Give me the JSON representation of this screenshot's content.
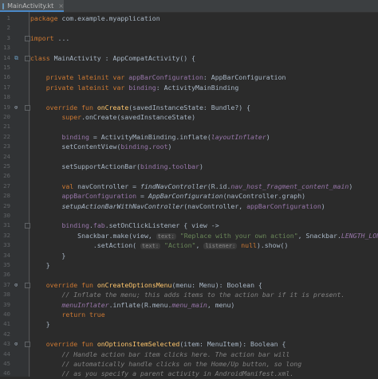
{
  "tab": {
    "label": "MainActivity.kt",
    "close": "×",
    "icon": "kotlin-file-icon"
  },
  "colors": {
    "keyword": "#cc7832",
    "function": "#ffc66d",
    "string": "#6a8759",
    "comment": "#808080",
    "field": "#9876aa",
    "text": "#a9b7c6",
    "background": "#2b2b2b",
    "gutter": "#313335"
  },
  "lines": [
    {
      "n": "1",
      "s": [
        [
          "kw",
          "package "
        ],
        [
          "",
          "com.example.myapplication"
        ]
      ]
    },
    {
      "n": "2",
      "s": []
    },
    {
      "n": "3",
      "s": [
        [
          "kw",
          "import "
        ],
        [
          "",
          "..."
        ]
      ],
      "fold": true
    },
    {
      "n": "13",
      "s": []
    },
    {
      "n": "14",
      "s": [
        [
          "kw",
          "class "
        ],
        [
          "",
          "MainActivity : AppCompatActivity() {"
        ]
      ],
      "marker": "class",
      "fold": true
    },
    {
      "n": "15",
      "s": []
    },
    {
      "n": "16",
      "s": [
        [
          "",
          "    "
        ],
        [
          "kw",
          "private lateinit var "
        ],
        [
          "fld",
          "appBarConfiguration"
        ],
        [
          "",
          ": AppBarConfiguration"
        ]
      ]
    },
    {
      "n": "17",
      "s": [
        [
          "",
          "    "
        ],
        [
          "kw",
          "private lateinit var "
        ],
        [
          "fld",
          "binding"
        ],
        [
          "",
          ": ActivityMainBinding"
        ]
      ]
    },
    {
      "n": "18",
      "s": []
    },
    {
      "n": "19",
      "s": [
        [
          "",
          "    "
        ],
        [
          "kw",
          "override fun "
        ],
        [
          "fn",
          "onCreate"
        ],
        [
          "",
          "(savedInstanceState: Bundle?) {"
        ]
      ],
      "marker": "override",
      "fold": true
    },
    {
      "n": "20",
      "s": [
        [
          "",
          "        "
        ],
        [
          "kw",
          "super"
        ],
        [
          "",
          ".onCreate(savedInstanceState)"
        ]
      ]
    },
    {
      "n": "21",
      "s": []
    },
    {
      "n": "22",
      "s": [
        [
          "",
          "        "
        ],
        [
          "fld",
          "binding"
        ],
        [
          "",
          " = ActivityMainBinding.inflate("
        ],
        [
          "fldi",
          "layoutInflater"
        ],
        [
          "",
          ")"
        ]
      ]
    },
    {
      "n": "23",
      "s": [
        [
          "",
          "        setContentView("
        ],
        [
          "fld",
          "binding"
        ],
        [
          "",
          "."
        ],
        [
          "fld",
          "root"
        ],
        [
          "",
          ")"
        ]
      ]
    },
    {
      "n": "24",
      "s": []
    },
    {
      "n": "25",
      "s": [
        [
          "",
          "        setSupportActionBar("
        ],
        [
          "fld",
          "binding"
        ],
        [
          "",
          "."
        ],
        [
          "fld",
          "toolbar"
        ],
        [
          "",
          ")"
        ]
      ]
    },
    {
      "n": "26",
      "s": []
    },
    {
      "n": "27",
      "s": [
        [
          "",
          "        "
        ],
        [
          "kw",
          "val "
        ],
        [
          "",
          "navController = "
        ],
        [
          "it",
          "findNavController"
        ],
        [
          "",
          "(R.id."
        ],
        [
          "fldi",
          "nav_host_fragment_content_main"
        ],
        [
          "",
          ")"
        ]
      ]
    },
    {
      "n": "28",
      "s": [
        [
          "",
          "        "
        ],
        [
          "fld",
          "appBarConfiguration"
        ],
        [
          "",
          " = "
        ],
        [
          "it",
          "AppBarConfiguration"
        ],
        [
          "",
          "(navController.graph)"
        ]
      ]
    },
    {
      "n": "29",
      "s": [
        [
          "",
          "        "
        ],
        [
          "it",
          "setupActionBarWithNavController"
        ],
        [
          "",
          "(navController, "
        ],
        [
          "fld",
          "appBarConfiguration"
        ],
        [
          "",
          ")"
        ]
      ]
    },
    {
      "n": "30",
      "s": []
    },
    {
      "n": "31",
      "s": [
        [
          "",
          "        "
        ],
        [
          "fld",
          "binding"
        ],
        [
          "",
          "."
        ],
        [
          "fld",
          "fab"
        ],
        [
          "",
          ".setOnClickListener { view ->"
        ]
      ],
      "fold": true
    },
    {
      "n": "32",
      "s": [
        [
          "",
          "            Snackbar.make(view, "
        ],
        [
          "hint",
          "text:"
        ],
        [
          "",
          " "
        ],
        [
          "str",
          "\"Replace with your own action\""
        ],
        [
          "",
          ", Snackbar."
        ],
        [
          "fldi",
          "LENGTH_LONG"
        ],
        [
          "",
          ")"
        ]
      ]
    },
    {
      "n": "33",
      "s": [
        [
          "",
          "                .setAction( "
        ],
        [
          "hint",
          "text:"
        ],
        [
          "",
          " "
        ],
        [
          "str",
          "\"Action\""
        ],
        [
          "",
          ", "
        ],
        [
          "hint",
          "listener:"
        ],
        [
          "",
          " "
        ],
        [
          "kw",
          "null"
        ],
        [
          "",
          ").show()"
        ]
      ]
    },
    {
      "n": "34",
      "s": [
        [
          "",
          "        }"
        ]
      ]
    },
    {
      "n": "35",
      "s": [
        [
          "",
          "    }"
        ]
      ]
    },
    {
      "n": "36",
      "s": []
    },
    {
      "n": "37",
      "s": [
        [
          "",
          "    "
        ],
        [
          "kw",
          "override fun "
        ],
        [
          "fn",
          "onCreateOptionsMenu"
        ],
        [
          "",
          "(menu: Menu): Boolean {"
        ]
      ],
      "marker": "override",
      "fold": true
    },
    {
      "n": "38",
      "s": [
        [
          "",
          "        "
        ],
        [
          "cm",
          "// Inflate the menu; this adds items to the action bar if it is present."
        ]
      ]
    },
    {
      "n": "39",
      "s": [
        [
          "",
          "        "
        ],
        [
          "fldi",
          "menuInflater"
        ],
        [
          "",
          ".inflate(R.menu."
        ],
        [
          "fldi",
          "menu_main"
        ],
        [
          "",
          ", menu)"
        ]
      ]
    },
    {
      "n": "40",
      "s": [
        [
          "",
          "        "
        ],
        [
          "kw",
          "return true"
        ]
      ]
    },
    {
      "n": "41",
      "s": [
        [
          "",
          "    }"
        ]
      ]
    },
    {
      "n": "42",
      "s": []
    },
    {
      "n": "43",
      "s": [
        [
          "",
          "    "
        ],
        [
          "kw",
          "override fun "
        ],
        [
          "fn",
          "onOptionsItemSelected"
        ],
        [
          "",
          "(item: MenuItem): Boolean {"
        ]
      ],
      "marker": "override",
      "fold": true
    },
    {
      "n": "44",
      "s": [
        [
          "",
          "        "
        ],
        [
          "cm",
          "// Handle action bar item clicks here. The action bar will"
        ]
      ]
    },
    {
      "n": "45",
      "s": [
        [
          "",
          "        "
        ],
        [
          "cm",
          "// automatically handle clicks on the Home/Up button, so long"
        ]
      ]
    },
    {
      "n": "46",
      "s": [
        [
          "",
          "        "
        ],
        [
          "cm",
          "// as you specify a parent activity in AndroidManifest.xml."
        ]
      ]
    }
  ]
}
